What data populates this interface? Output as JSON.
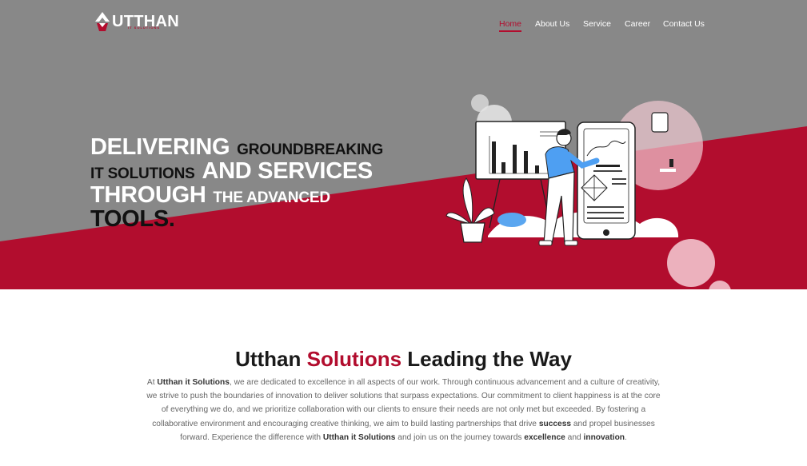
{
  "brand": {
    "name": "UTTHAN",
    "tagline": "IT SOLUTIONS"
  },
  "nav": {
    "items": [
      {
        "label": "Home",
        "active": true
      },
      {
        "label": "About Us",
        "active": false
      },
      {
        "label": "Service",
        "active": false
      },
      {
        "label": "Career",
        "active": false
      },
      {
        "label": "Contact Us",
        "active": false
      }
    ]
  },
  "hero": {
    "line1_big": "DELIVERING",
    "line1_small": "GROUNDBREAKING",
    "line2_small": "IT SOLUTIONS",
    "line2_big": "AND SERVICES",
    "line3_big": "THROUGH",
    "line3_small": "THE ADVANCED",
    "line4_big": "TOOLS."
  },
  "about": {
    "title_pre": "Utthan ",
    "title_accent": "Solutions",
    "title_post": " Leading the Way",
    "p1": "At ",
    "b1": "Utthan it Solutions",
    "p2": ", we are dedicated to excellence in all aspects of our work. Through continuous advancement and a culture of creativity, we strive to push the boundaries of innovation to deliver solutions that surpass expectations. Our commitment to client happiness is at the core of everything we do, and we prioritize collaboration with our clients to ensure their needs are not only met but exceeded. By fostering a collaborative environment and encouraging creative thinking, we aim to build lasting partnerships that drive ",
    "b2": "success",
    "p3": " and propel businesses forward. Experience the difference with ",
    "b3": "Utthan it Solutions",
    "p4": " and join us on the journey towards ",
    "b4": "excellence",
    "p5": " and ",
    "b5": "innovation",
    "p6": "."
  },
  "colors": {
    "brand_red": "#b20d2e",
    "hero_gray": "#888888",
    "text_dark": "#1a1a1a",
    "text_body": "#666666"
  }
}
